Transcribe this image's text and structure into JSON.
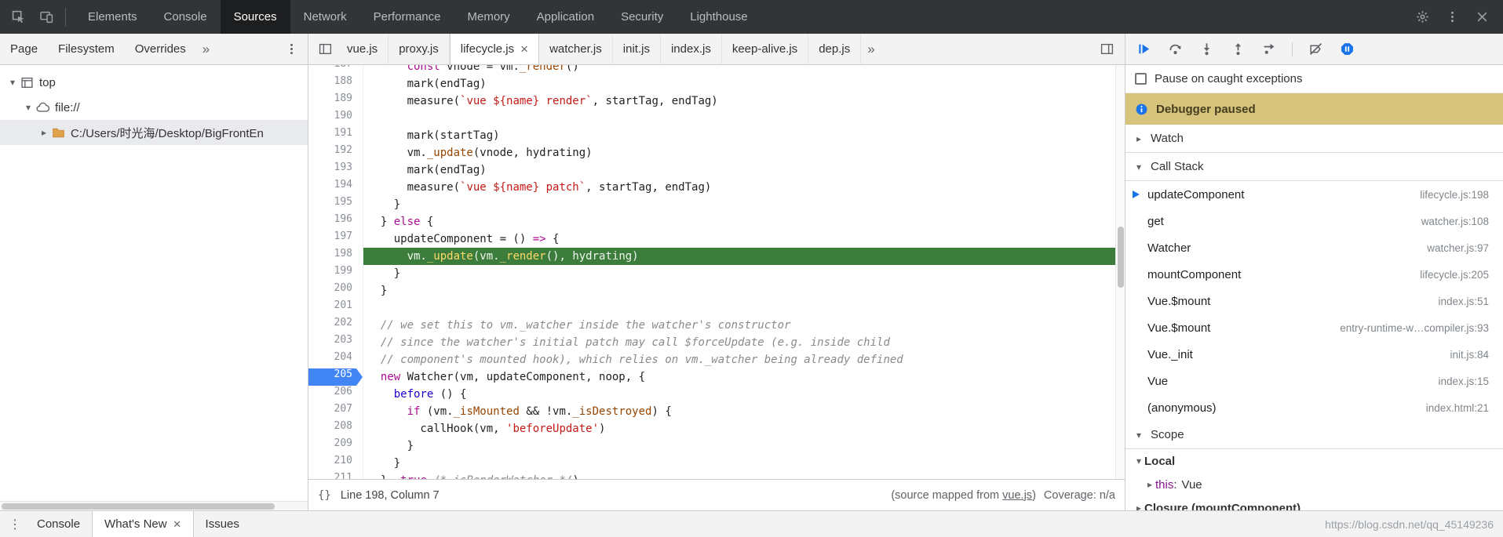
{
  "colors": {
    "accent": "#1a73e8",
    "exec_line_bg": "#3c7d3c",
    "breakpoint_bg": "#4285f4",
    "paused_banner_bg": "#d6c37c"
  },
  "main_toolbar": {
    "left_icons": [
      "inspect-icon",
      "device-toolbar-icon"
    ],
    "tabs": [
      {
        "label": "Elements"
      },
      {
        "label": "Console"
      },
      {
        "label": "Sources",
        "active": true
      },
      {
        "label": "Network"
      },
      {
        "label": "Performance"
      },
      {
        "label": "Memory"
      },
      {
        "label": "Application"
      },
      {
        "label": "Security"
      },
      {
        "label": "Lighthouse"
      }
    ],
    "right_icons": [
      "settings-gear-icon",
      "kebab-icon",
      "close-icon"
    ]
  },
  "navigator": {
    "tabs": [
      {
        "label": "Page"
      },
      {
        "label": "Filesystem"
      },
      {
        "label": "Overrides"
      }
    ],
    "overflow_chevron": "»",
    "tree": [
      {
        "level": 0,
        "expanded": true,
        "icon": "frame-icon",
        "label": "top"
      },
      {
        "level": 1,
        "expanded": true,
        "icon": "cloud-icon",
        "label": "file://"
      },
      {
        "level": 2,
        "expanded": false,
        "icon": "folder-icon",
        "label": "C:/Users/时光海/Desktop/BigFrontEn",
        "selected": true
      }
    ]
  },
  "editor": {
    "tabs": [
      {
        "label": "vue.js"
      },
      {
        "label": "proxy.js"
      },
      {
        "label": "lifecycle.js",
        "active": true,
        "closable": true
      },
      {
        "label": "watcher.js"
      },
      {
        "label": "init.js"
      },
      {
        "label": "index.js"
      },
      {
        "label": "keep-alive.js"
      },
      {
        "label": "dep.js"
      }
    ],
    "overflow_chevron": "»",
    "first_line": 187,
    "exec_line": 198,
    "breakpoint_line": 205,
    "lines": [
      [
        [
          "pln",
          "      "
        ],
        [
          "kwd",
          "const"
        ],
        [
          "pln",
          " vnode = vm."
        ],
        [
          "prop",
          "_render"
        ],
        [
          "pln",
          "()"
        ]
      ],
      [
        [
          "pln",
          "      mark(endTag)"
        ]
      ],
      [
        [
          "pln",
          "      measure("
        ],
        [
          "str",
          "`vue ${name} render`"
        ],
        [
          "pln",
          ", startTag, endTag)"
        ]
      ],
      [],
      [
        [
          "pln",
          "      mark(startTag)"
        ]
      ],
      [
        [
          "pln",
          "      vm."
        ],
        [
          "prop",
          "_update"
        ],
        [
          "pln",
          "(vnode, hydrating)"
        ]
      ],
      [
        [
          "pln",
          "      mark(endTag)"
        ]
      ],
      [
        [
          "pln",
          "      measure("
        ],
        [
          "str",
          "`vue ${name} patch`"
        ],
        [
          "pln",
          ", startTag, endTag)"
        ]
      ],
      [
        [
          "pln",
          "    }"
        ]
      ],
      [
        [
          "pln",
          "  } "
        ],
        [
          "kwd",
          "else"
        ],
        [
          "pln",
          " {"
        ]
      ],
      [
        [
          "pln",
          "    updateComponent = () "
        ],
        [
          "kwd",
          "=>"
        ],
        [
          "pln",
          " {"
        ]
      ],
      [
        [
          "pln",
          "      vm."
        ],
        [
          "prop",
          "_update"
        ],
        [
          "pln",
          "(vm."
        ],
        [
          "prop",
          "_render"
        ],
        [
          "pln",
          "(), hydrating)"
        ]
      ],
      [
        [
          "pln",
          "    }"
        ]
      ],
      [
        [
          "pln",
          "  }"
        ]
      ],
      [],
      [
        [
          "pln",
          "  "
        ],
        [
          "com",
          "// we set this to vm._watcher inside the watcher's constructor"
        ]
      ],
      [
        [
          "pln",
          "  "
        ],
        [
          "com",
          "// since the watcher's initial patch may call $forceUpdate (e.g. inside child"
        ]
      ],
      [
        [
          "pln",
          "  "
        ],
        [
          "com",
          "// component's mounted hook), which relies on vm._watcher being already defined"
        ]
      ],
      [
        [
          "pln",
          "  "
        ],
        [
          "kwd",
          "new"
        ],
        [
          "pln",
          " Watcher(vm, updateComponent, noop, {"
        ]
      ],
      [
        [
          "pln",
          "    "
        ],
        [
          "def",
          "before"
        ],
        [
          "pln",
          " () {"
        ]
      ],
      [
        [
          "pln",
          "      "
        ],
        [
          "kwd",
          "if"
        ],
        [
          "pln",
          " (vm."
        ],
        [
          "prop",
          "_isMounted"
        ],
        [
          "pln",
          " && !vm."
        ],
        [
          "prop",
          "_isDestroyed"
        ],
        [
          "pln",
          ") {"
        ]
      ],
      [
        [
          "pln",
          "        callHook(vm, "
        ],
        [
          "str",
          "'beforeUpdate'"
        ],
        [
          "pln",
          ")"
        ]
      ],
      [
        [
          "pln",
          "      }"
        ]
      ],
      [
        [
          "pln",
          "    }"
        ]
      ],
      [
        [
          "pln",
          "  }, "
        ],
        [
          "kwd",
          "true"
        ],
        [
          "pln",
          " "
        ],
        [
          "com",
          "/* isRenderWatcher */"
        ],
        [
          "pln",
          ")"
        ]
      ]
    ],
    "status": {
      "braces": "{}",
      "line_col": "Line 198, Column 7",
      "mapped_pre": "(source mapped from ",
      "mapped_link": "vue.js",
      "mapped_post": ")",
      "coverage": "Coverage: n/a"
    }
  },
  "debugger": {
    "toolbar": [
      {
        "icon": "resume-icon",
        "accent": true
      },
      {
        "icon": "step-over-icon"
      },
      {
        "icon": "step-into-icon"
      },
      {
        "icon": "step-out-icon"
      },
      {
        "icon": "step-icon"
      },
      {
        "sep": true
      },
      {
        "icon": "deactivate-breakpoints-icon"
      },
      {
        "icon": "pause-on-exceptions-icon",
        "accent": true
      }
    ],
    "pause_on_caught_label": "Pause on caught exceptions",
    "pause_on_caught_checked": false,
    "paused_banner": {
      "icon": "info-icon",
      "label": "Debugger paused"
    },
    "sections": {
      "watch": "Watch",
      "call_stack": "Call Stack",
      "scope": "Scope"
    },
    "call_stack": [
      {
        "name": "updateComponent",
        "loc": "lifecycle.js:198",
        "active": true
      },
      {
        "name": "get",
        "loc": "watcher.js:108"
      },
      {
        "name": "Watcher",
        "loc": "watcher.js:97"
      },
      {
        "name": "mountComponent",
        "loc": "lifecycle.js:205"
      },
      {
        "name": "Vue.$mount",
        "loc": "index.js:51"
      },
      {
        "name": "Vue.$mount",
        "loc": "entry-runtime-w…compiler.js:93"
      },
      {
        "name": "Vue._init",
        "loc": "init.js:84"
      },
      {
        "name": "Vue",
        "loc": "index.js:15"
      },
      {
        "name": "(anonymous)",
        "loc": "index.html:21"
      }
    ],
    "scope": [
      {
        "kind": "group",
        "label": "Local",
        "expanded": true
      },
      {
        "kind": "prop",
        "name": "this",
        "value": "Vue"
      },
      {
        "kind": "group",
        "label": "Closure (mountComponent)",
        "expanded": false
      }
    ]
  },
  "drawer": {
    "tabs": [
      {
        "label": "Console"
      },
      {
        "label": "What's New",
        "active": true,
        "closable": true
      },
      {
        "label": "Issues"
      }
    ]
  },
  "watermark": "https://blog.csdn.net/qq_45149236"
}
